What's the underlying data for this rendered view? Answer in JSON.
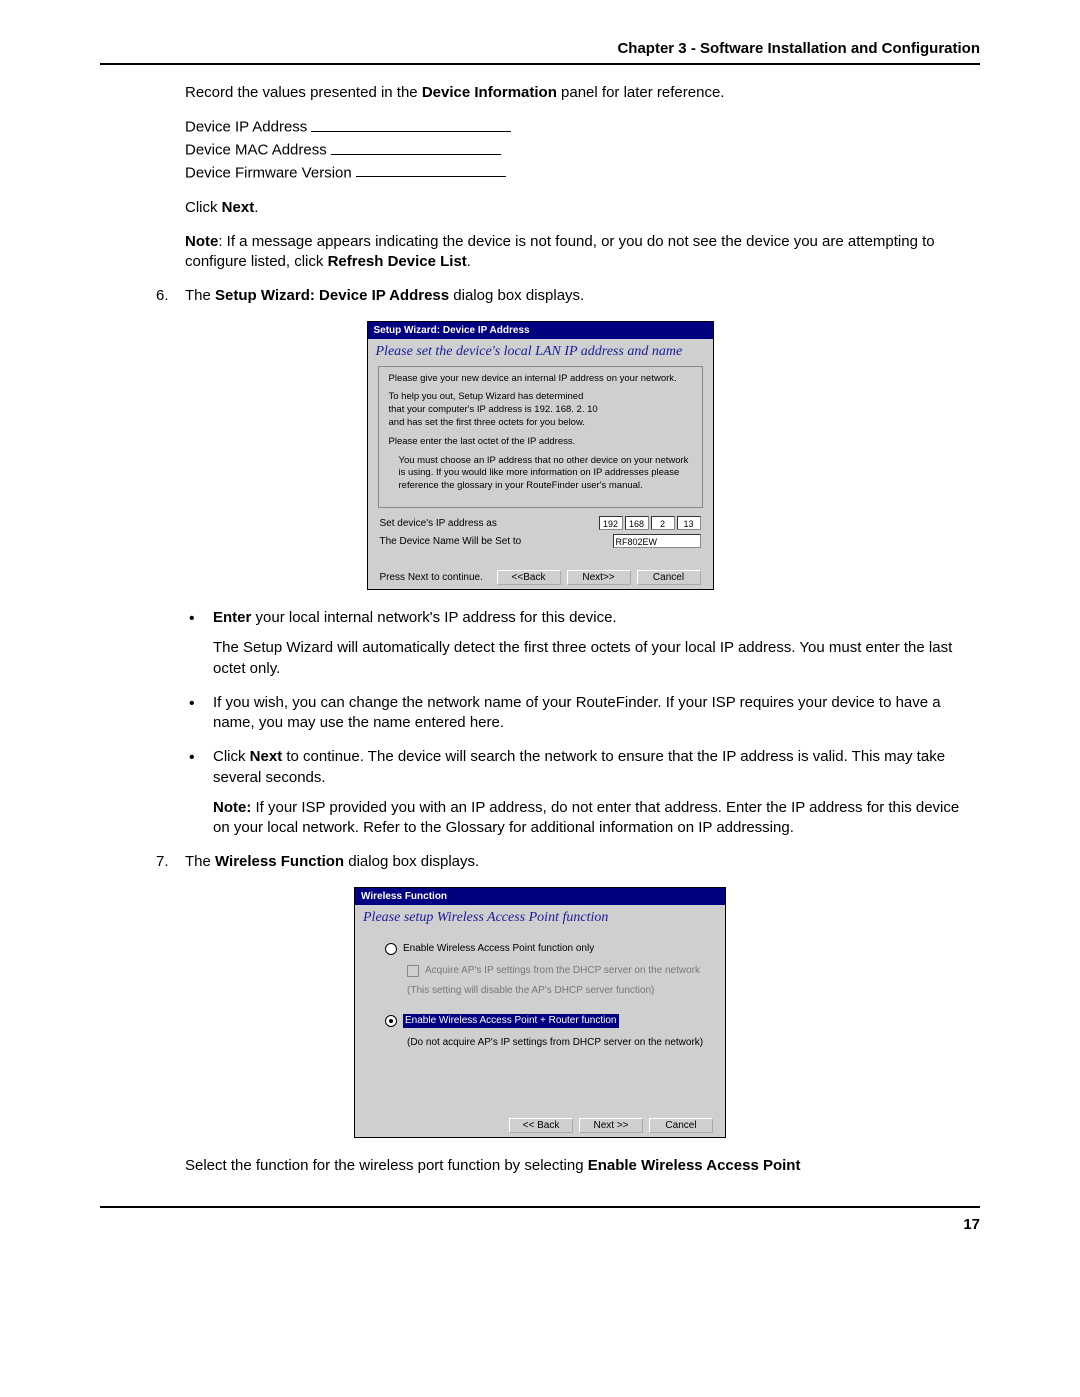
{
  "header": {
    "chapter": "Chapter 3 - Software Installation and Configuration"
  },
  "intro": {
    "record": [
      "Record the values presented in the ",
      "Device Information",
      " panel for later reference."
    ],
    "fields": {
      "ip": "Device IP Address",
      "mac": "Device MAC Address",
      "fw": "Device Firmware Version"
    },
    "click_next": [
      "Click ",
      "Next",
      "."
    ],
    "note": [
      "Note",
      ": If a message appears indicating the device is not found, or you do not see the device you are attempting to configure listed, click ",
      "Refresh Device List",
      "."
    ]
  },
  "step6": {
    "num": "6.",
    "text": [
      "The ",
      "Setup Wizard: Device IP Address",
      " dialog box displays."
    ]
  },
  "dialog1": {
    "title": "Setup Wizard: Device IP Address",
    "instr": "Please set the device's local LAN IP address and name",
    "p1": "Please give your new device an internal IP address on your network.",
    "p2": "To help you out, Setup Wizard has determined\nthat your computer's IP address is 192. 168. 2. 10\nand has set the first three octets for you below.",
    "p3": "Please enter the last octet of the IP address.",
    "p4": "You must choose an IP address that no other device on your network is using.  If you would like more information on IP addresses please reference the glossary in your RouteFinder user's manual.",
    "row_ip_label": "Set device's IP address as",
    "oct1": "192",
    "oct2": "168",
    "oct3": "2",
    "oct4": "13",
    "row_name_label": "The Device Name Will be Set to",
    "name_value": "RF802EW",
    "press_next": "Press Next to continue.",
    "btn_back": "<<Back",
    "btn_next": "Next>>",
    "btn_cancel": "Cancel"
  },
  "bullets1": {
    "b1": [
      "Enter",
      " your local internal network's IP address for this device."
    ],
    "b1_sub": "The Setup Wizard will automatically detect the first three octets of your local IP address.  You must enter the last octet only.",
    "b2": "If you wish, you can change the network name of your RouteFinder.  If your ISP requires your device to have a name, you may use the name entered here.",
    "b3": [
      "Click ",
      "Next",
      " to continue.  The device will search the network to ensure that the IP address is valid.  This may take several seconds."
    ],
    "b3_note": [
      "Note:",
      " If your ISP provided you with an IP address, do not enter that address.  Enter the IP address for this device on your local network.  Refer to the Glossary for additional information on IP addressing."
    ]
  },
  "step7": {
    "num": "7.",
    "text": [
      "The ",
      "Wireless Function",
      " dialog box displays."
    ]
  },
  "dialog2": {
    "title": "Wireless Function",
    "instr": "Please setup Wireless Access Point function",
    "opt1": "Enable Wireless Access Point function only",
    "opt1_check": "Acquire AP's IP settings from the DHCP server on the network",
    "opt1_desc": "(This setting will disable the AP's DHCP server function)",
    "opt2": "Enable Wireless Access Point + Router function",
    "opt2_desc": "(Do not acquire AP's IP settings from DHCP server on the network)",
    "btn_back": "<< Back",
    "btn_next": "Next >>",
    "btn_cancel": "Cancel"
  },
  "closing": [
    "Select the function for the wireless port function by selecting ",
    "Enable Wireless Access Point"
  ],
  "pagenum": "17"
}
